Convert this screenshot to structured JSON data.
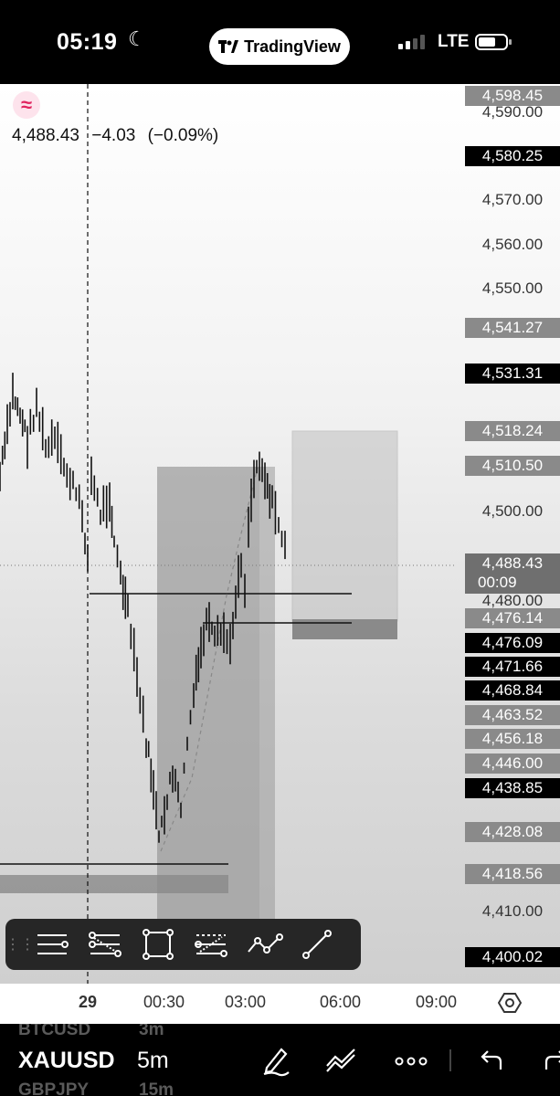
{
  "status": {
    "time": "05:19",
    "network": "LTE",
    "app_pill": "TradingView"
  },
  "quote": {
    "price": "4,488.43",
    "change": "−4.03",
    "change_pct": "(−0.09%)"
  },
  "price_scale": {
    "ticks": [
      "4,590.00",
      "4,570.00",
      "4,560.00",
      "4,550.00",
      "4,500.00",
      "4,480.00",
      "4,410.00"
    ],
    "tags": [
      {
        "label": "4,598.45",
        "style": "grey"
      },
      {
        "label": "4,580.25",
        "style": "black"
      },
      {
        "label": "4,541.27",
        "style": "grey"
      },
      {
        "label": "4,531.31",
        "style": "black"
      },
      {
        "label": "4,518.24",
        "style": "grey"
      },
      {
        "label": "4,510.50",
        "style": "grey"
      },
      {
        "label": "4,488.43",
        "style": "grey"
      },
      {
        "label": "4,476.14",
        "style": "grey"
      },
      {
        "label": "4,476.09",
        "style": "black"
      },
      {
        "label": "4,471.66",
        "style": "black"
      },
      {
        "label": "4,468.84",
        "style": "black"
      },
      {
        "label": "4,463.52",
        "style": "grey"
      },
      {
        "label": "4,456.18",
        "style": "grey"
      },
      {
        "label": "4,446.00",
        "style": "grey"
      },
      {
        "label": "4,438.85",
        "style": "black"
      },
      {
        "label": "4,428.08",
        "style": "grey"
      },
      {
        "label": "4,418.56",
        "style": "grey"
      },
      {
        "label": "4,400.02",
        "style": "black"
      }
    ],
    "countdown": "00:09"
  },
  "time_axis": {
    "ticks": [
      "29",
      "00:30",
      "03:00",
      "06:00",
      "09:00"
    ]
  },
  "toolbar": {
    "tools": [
      "horizontal-lines-tool",
      "fib-tool",
      "rectangle-tool",
      "parallel-channel-tool",
      "path-tool",
      "trend-line-tool"
    ]
  },
  "bottom": {
    "symbol": "XAUUSD",
    "timeframe": "5m",
    "ghost_above": {
      "symbol": "BTCUSD",
      "tf": "3m"
    },
    "ghost_below": {
      "symbol": "GBPJPY",
      "tf": "15m"
    }
  },
  "colors": {
    "background": "#ffffff",
    "statusbar": "#000000",
    "candle": "#111111",
    "accent": "#e0245e"
  }
}
